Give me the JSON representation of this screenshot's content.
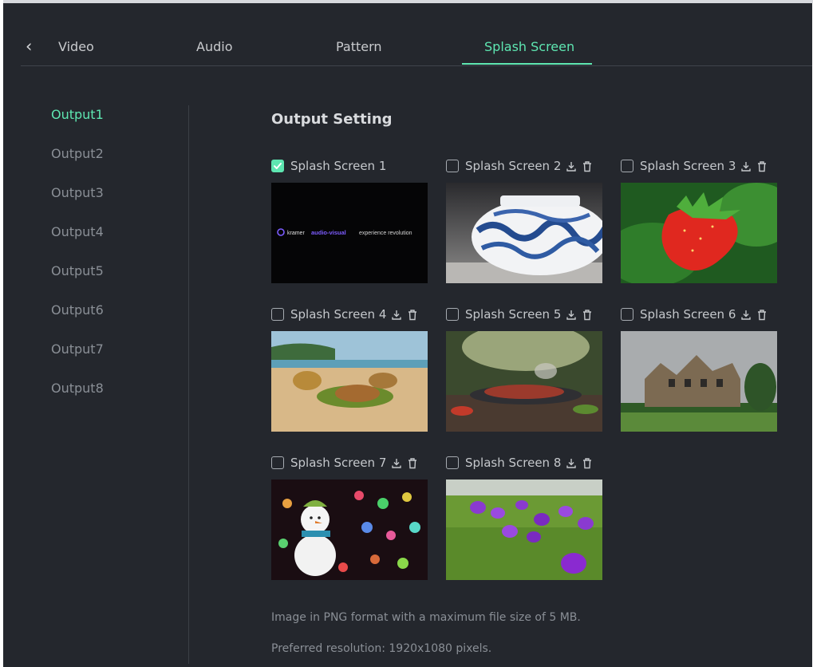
{
  "tabs": [
    {
      "label": "Video"
    },
    {
      "label": "Audio"
    },
    {
      "label": "Pattern"
    },
    {
      "label": "Splash Screen"
    }
  ],
  "active_tab": "Splash Screen",
  "outputs": [
    "Output1",
    "Output2",
    "Output3",
    "Output4",
    "Output5",
    "Output6",
    "Output7",
    "Output8"
  ],
  "active_output": "Output1",
  "section_title": "Output Setting",
  "splash_screens": [
    {
      "label": "Splash Screen 1",
      "checked": true
    },
    {
      "label": "Splash Screen 2",
      "checked": false
    },
    {
      "label": "Splash Screen 3",
      "checked": false
    },
    {
      "label": "Splash Screen 4",
      "checked": false
    },
    {
      "label": "Splash Screen 5",
      "checked": false
    },
    {
      "label": "Splash Screen 6",
      "checked": false
    },
    {
      "label": "Splash Screen 7",
      "checked": false
    },
    {
      "label": "Splash Screen 8",
      "checked": false
    }
  ],
  "kramer_banner": {
    "brand": "kramer",
    "highlight": "audio-visual",
    "tagline": "experience revolution"
  },
  "notes": {
    "format": "Image in PNG format with a maximum file size of 5 MB.",
    "resolution": "Preferred resolution: 1920x1080 pixels."
  },
  "colors": {
    "accent": "#5ee6b1",
    "background": "#24272d",
    "text_muted": "#8a8f96"
  }
}
